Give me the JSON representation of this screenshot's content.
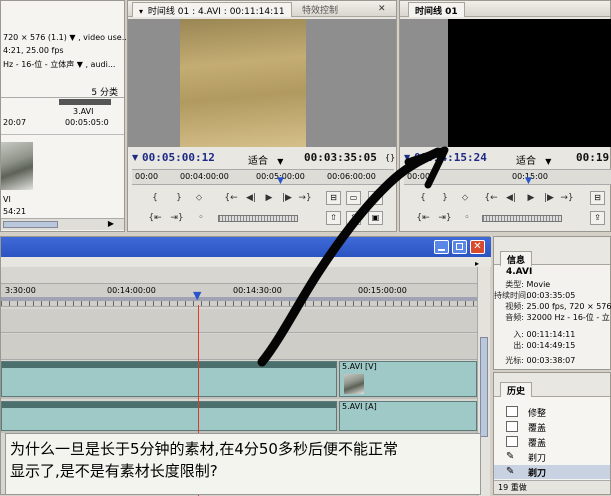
{
  "project": {
    "line1": "720 × 576 (1.1) ▼ , video use...",
    "line2": "4:21, 25.00 fps",
    "line3": "Hz - 16-位 - 立体声 ▼ , audi...",
    "count": "5 分类",
    "items": [
      {
        "name": "3.AVI",
        "duration": "00:05:05:0"
      },
      {
        "name": "",
        "duration": "20:07"
      }
    ],
    "thumb_label": "VI",
    "thumb_duration": "54:21"
  },
  "source_monitor": {
    "tab_title": "时间线 01 : 4.AVI : 00:11:14:11",
    "tab_effects": "特效控制",
    "current_tc": "00:05:00:12",
    "fit": "适合",
    "duration_tc": "00:03:35:05",
    "ruler": [
      "00:00",
      "00:04:00:00",
      "00:05:00:00",
      "00:06:00:00"
    ]
  },
  "program_monitor": {
    "tab_title": "时间线 01",
    "current_tc": "00:14:15:24",
    "fit": "适合",
    "duration_tc": "00:19:",
    "ruler": [
      "00:00",
      "00:15:00"
    ]
  },
  "timeline": {
    "ruler": [
      "3:30:00",
      "00:14:00:00",
      "00:14:30:00",
      "00:15:00:00"
    ],
    "video_clip": "5.AVI [V]",
    "audio_clip": "5.AVI [A]"
  },
  "info": {
    "tab": "信息",
    "clip": "4.AVI",
    "rows": [
      {
        "k": "类型:",
        "v": "Movie"
      },
      {
        "k": "持续时间:",
        "v": "00:03:35:05"
      },
      {
        "k": "视频:",
        "v": "25.00 fps, 720 × 576"
      },
      {
        "k": "音频:",
        "v": "32000 Hz - 16-位 - 立"
      },
      {
        "k": "入:",
        "v": "00:11:14:11"
      },
      {
        "k": "出:",
        "v": "00:14:49:15"
      },
      {
        "k": "光标:",
        "v": "00:03:38:07"
      }
    ]
  },
  "history": {
    "tab": "历史",
    "items": [
      "修整",
      "覆盖",
      "覆盖",
      "剃刀",
      "剃刀"
    ],
    "footer": "19 重做"
  },
  "caption": {
    "line1": "为什么一旦是长于5分钟的素材,在4分50多秒后便不能正常",
    "line2": "显示了,是不是有素材长度限制?"
  }
}
